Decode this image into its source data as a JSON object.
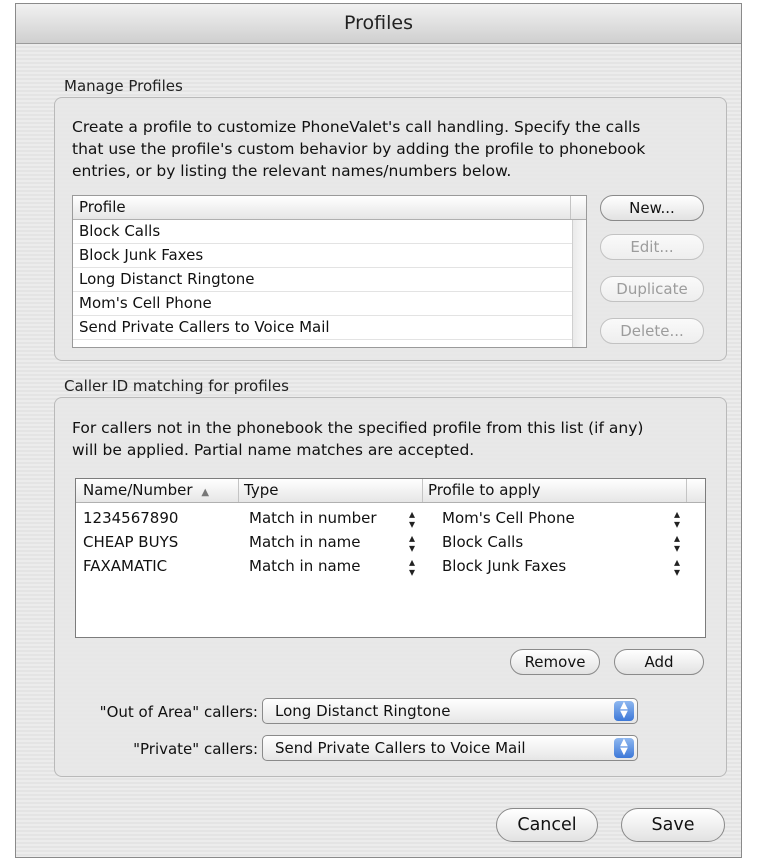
{
  "window": {
    "title": "Profiles"
  },
  "manage": {
    "label": "Manage Profiles",
    "description_lines": [
      "Create a profile to customize PhoneValet's call handling. Specify the calls",
      "that use the profile's custom behavior by adding the profile to phonebook",
      "entries, or by listing the relevant names/numbers below."
    ],
    "list_header": "Profile",
    "profiles": [
      "Block Calls",
      "Block Junk Faxes",
      "Long Distanct Ringtone",
      "Mom's Cell Phone",
      "Send Private Callers to Voice Mail"
    ],
    "buttons": {
      "new": "New...",
      "edit": "Edit...",
      "duplicate": "Duplicate",
      "delete": "Delete..."
    }
  },
  "callerid": {
    "label": "Caller ID matching for profiles",
    "description_lines": [
      "For callers not in the phonebook the specified profile from this list (if any)",
      "will be applied. Partial name matches are accepted."
    ],
    "columns": {
      "name": "Name/Number",
      "sort_indicator": "▲",
      "type": "Type",
      "profile": "Profile to apply"
    },
    "rows": [
      {
        "name": "1234567890",
        "type": "Match in number",
        "profile": "Mom's Cell Phone"
      },
      {
        "name": "CHEAP BUYS",
        "type": "Match in name",
        "profile": "Block Calls"
      },
      {
        "name": "FAXAMATIC",
        "type": "Match in name",
        "profile": "Block Junk Faxes"
      }
    ],
    "buttons": {
      "remove": "Remove",
      "add": "Add"
    },
    "out_of_area": {
      "label": "\"Out of Area\" callers:",
      "value": "Long Distanct Ringtone"
    },
    "private": {
      "label": "\"Private\" callers:",
      "value": "Send Private Callers to Voice Mail"
    }
  },
  "footer": {
    "cancel": "Cancel",
    "save": "Save"
  }
}
